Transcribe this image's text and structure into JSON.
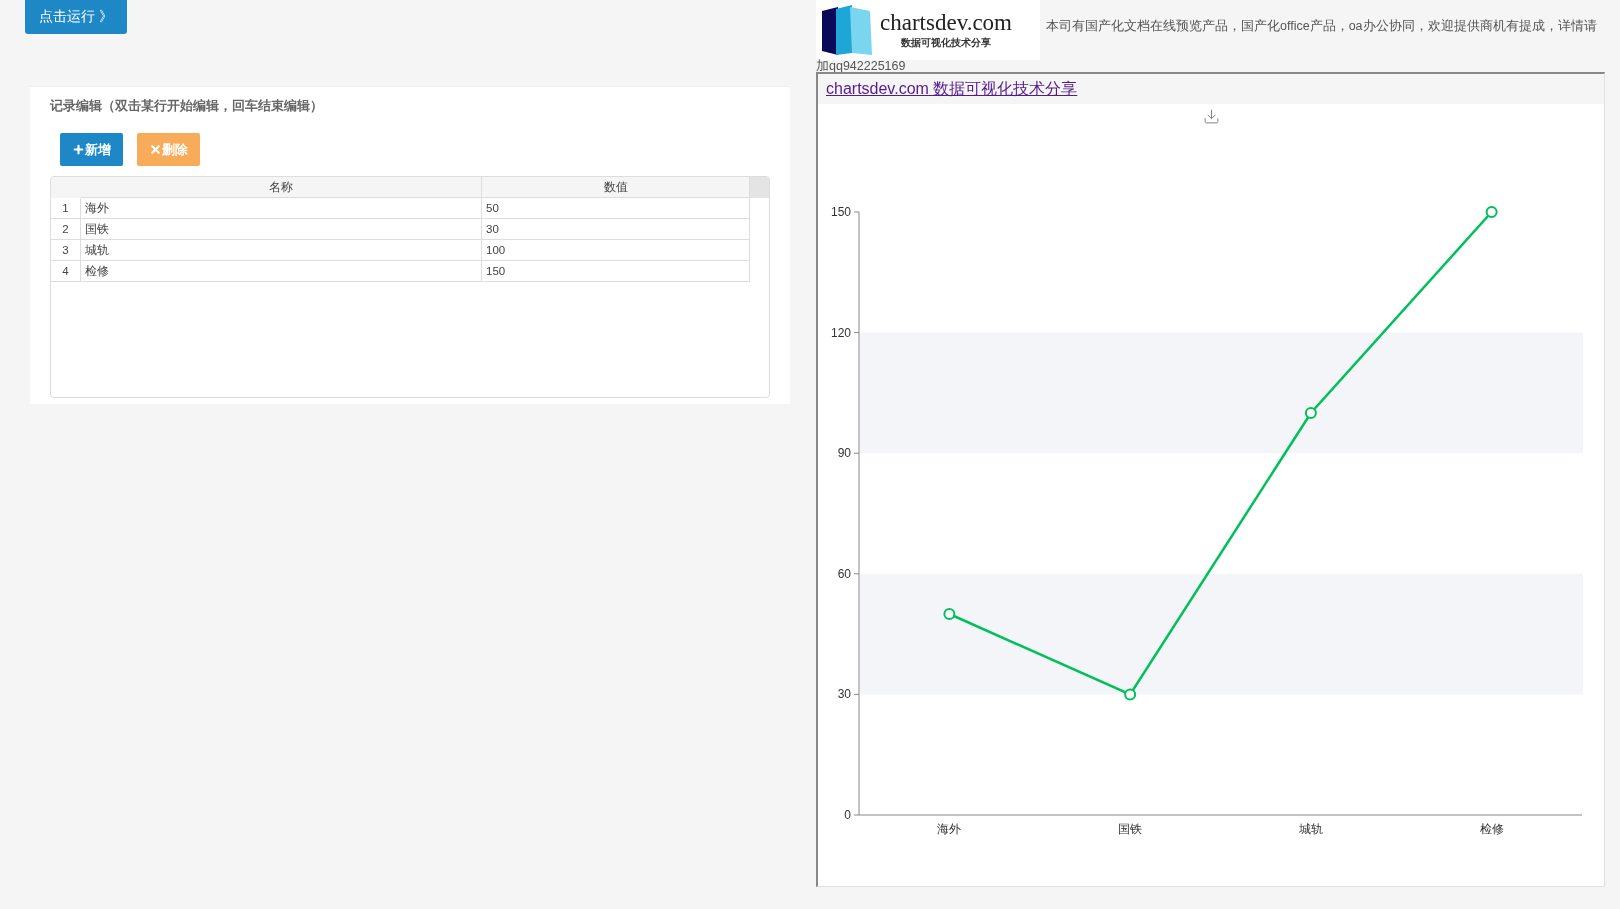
{
  "run_button": {
    "label": "点击运行 》"
  },
  "editor": {
    "title": "记录编辑（双击某行开始编辑，回车结束编辑）",
    "buttons": [
      {
        "kind": "add",
        "label": "新增"
      },
      {
        "kind": "delete",
        "label": "删除"
      }
    ],
    "table": {
      "columns": [
        "名称",
        "数值"
      ],
      "rows": [
        {
          "index": "1",
          "name": "海外",
          "value": "50"
        },
        {
          "index": "2",
          "name": "国铁",
          "value": "30"
        },
        {
          "index": "3",
          "name": "城轨",
          "value": "100"
        },
        {
          "index": "4",
          "name": "检修",
          "value": "150"
        }
      ]
    }
  },
  "brand": {
    "logo_name": "chartsdev.com",
    "logo_tagline": "数据可视化技术分享",
    "notice": "本司有国产化文档在线预览产品，国产化office产品，oa办公协同，欢迎提供商机有提成，详情请",
    "notice_contact": "加qq942225169"
  },
  "chart_panel": {
    "link": "chartsdev.com 数据可视化技术分享",
    "chart_data": {
      "type": "line",
      "categories": [
        "海外",
        "国铁",
        "城轨",
        "检修"
      ],
      "series": [
        {
          "color": "#00c05a",
          "marker": "circle",
          "values": [
            50,
            30,
            100,
            150
          ]
        }
      ],
      "ylim": [
        0,
        150
      ],
      "yticks": [
        0,
        30,
        60,
        90,
        120,
        150
      ]
    }
  }
}
